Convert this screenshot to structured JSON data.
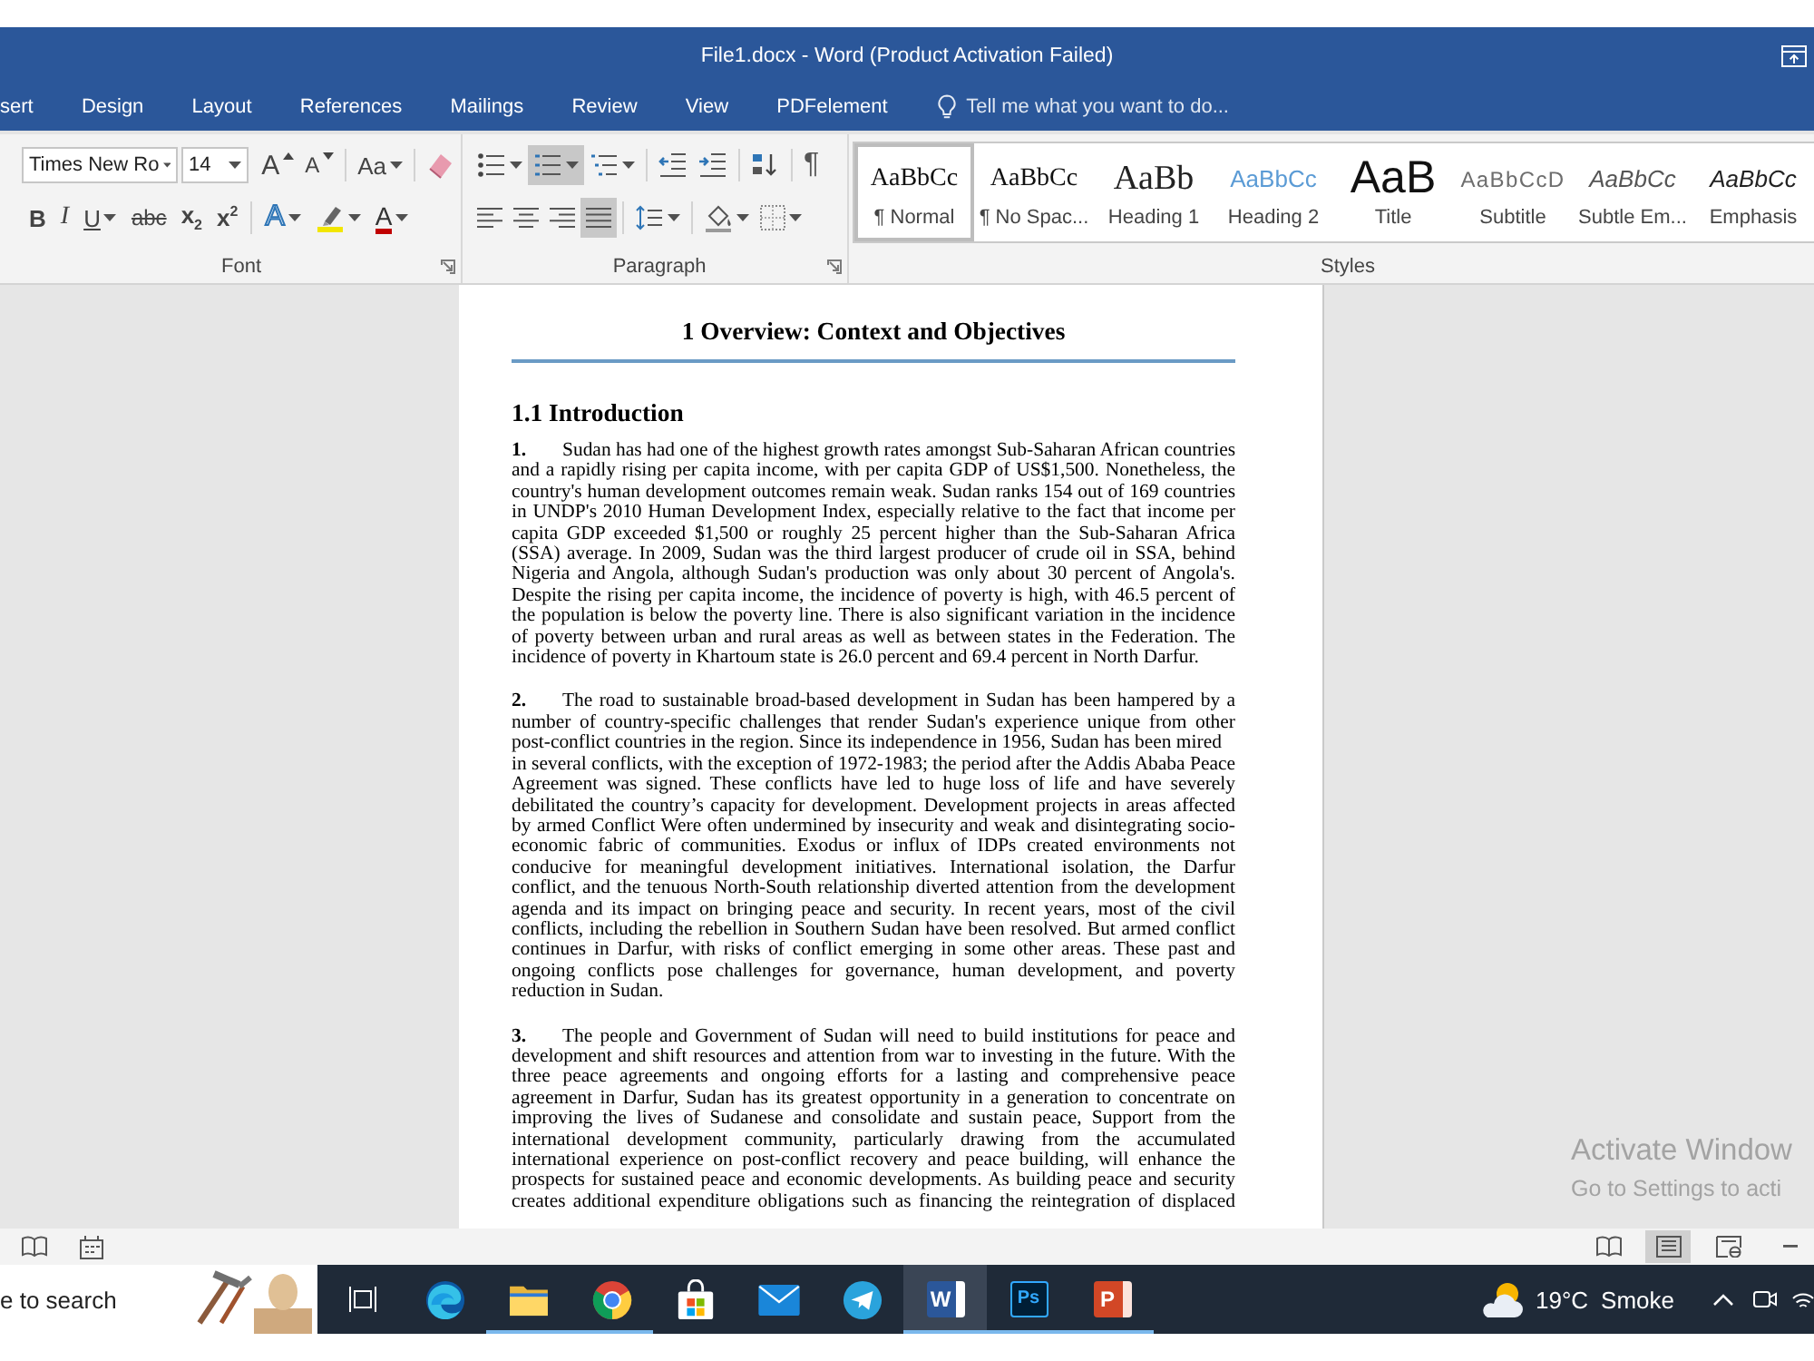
{
  "window": {
    "title": "File1.docx - Word (Product Activation Failed)"
  },
  "tabs": [
    {
      "label": "sert",
      "selected": false
    },
    {
      "label": "Design",
      "selected": false
    },
    {
      "label": "Layout",
      "selected": false
    },
    {
      "label": "References",
      "selected": false
    },
    {
      "label": "Mailings",
      "selected": false
    },
    {
      "label": "Review",
      "selected": false
    },
    {
      "label": "View",
      "selected": false
    },
    {
      "label": "PDFelement",
      "selected": false
    }
  ],
  "tell_me": {
    "placeholder": "Tell me what you want to do..."
  },
  "ribbon": {
    "font": {
      "label": "Font",
      "font_name": "Times New Ro",
      "font_size": "14",
      "row1": [
        {
          "kind": "grow",
          "label": "A"
        },
        {
          "kind": "shrink",
          "label": "A"
        },
        {
          "kind": "case",
          "label": "Aa"
        },
        {
          "kind": "clear"
        }
      ],
      "row2": [
        {
          "kind": "bold",
          "label": "B"
        },
        {
          "kind": "italic",
          "label": "I"
        },
        {
          "kind": "underline",
          "label": "U"
        },
        {
          "kind": "strike",
          "label": "abc"
        },
        {
          "kind": "sub",
          "label": "x$_{2}$"
        },
        {
          "kind": "super",
          "label": "x$^{2}$"
        },
        {
          "kind": "effects",
          "label": "A"
        },
        {
          "kind": "highlight"
        },
        {
          "kind": "color",
          "label": "A"
        }
      ]
    },
    "paragraph": {
      "label": "Paragraph",
      "row1": [
        {
          "kind": "bullets",
          "selected": false
        },
        {
          "kind": "numbering",
          "selected": true
        },
        {
          "kind": "multilevel",
          "selected": false
        },
        {
          "kind": "outdent",
          "selected": false
        },
        {
          "kind": "indent",
          "selected": false
        },
        {
          "kind": "sort",
          "selected": false
        },
        {
          "kind": "marks",
          "label": "¶",
          "selected": false
        }
      ],
      "row2": [
        {
          "kind": "left",
          "selected": false
        },
        {
          "kind": "center",
          "selected": false
        },
        {
          "kind": "right",
          "selected": false
        },
        {
          "kind": "justify",
          "selected": true
        },
        {
          "kind": "spacing",
          "selected": false
        },
        {
          "kind": "shading",
          "selected": false
        },
        {
          "kind": "borders",
          "selected": false
        }
      ]
    },
    "styles": {
      "label": "Styles",
      "items": [
        {
          "kind": "normal",
          "preview": "AaBbCc",
          "name": "¶ Normal",
          "selected": true
        },
        {
          "kind": "normal",
          "preview": "AaBbCc",
          "name": "¶ No Spac...",
          "selected": false
        },
        {
          "kind": "heading1",
          "preview": "AaBb",
          "name": "Heading 1",
          "selected": false
        },
        {
          "kind": "heading2",
          "preview": "AaBbCc",
          "name": "Heading 2",
          "selected": false
        },
        {
          "kind": "title",
          "preview": "AaB",
          "name": "Title",
          "selected": false
        },
        {
          "kind": "subtitle",
          "preview": "AaBbCcD",
          "name": "Subtitle",
          "selected": false
        },
        {
          "kind": "subtle",
          "preview": "AaBbCc",
          "name": "Subtle Em...",
          "selected": false
        },
        {
          "kind": "emphasis",
          "preview": "AaBbCc",
          "name": "Emphasis",
          "selected": false
        }
      ]
    }
  },
  "document": {
    "title": "1 Overview: Context and Objectives",
    "section": "1.1 Introduction",
    "paragraphs": [
      {
        "number": "1.",
        "text": "Sudan has had one of the highest growth rates amongst Sub-Saharan African countries and a rapidly rising per capita income, with per capita GDP of US$1,500. Nonetheless, the country's human development outcomes remain weak. Sudan ranks 154 out of 169 countries in UNDP's 2010 Human Development Index, especially relative to the fact that income per capita GDP exceeded $1,500 or roughly 25 percent higher than the Sub-Saharan Africa (SSA) average. In 2009, Sudan was the third largest producer of crude oil in SSA, behind Nigeria and Angola, although Sudan's production was only about 30 percent of Angola's. Despite the rising per capita income, the incidence of poverty is high, with 46.5 percent of the population is below the poverty line. There is also significant variation in the incidence of poverty between urban and rural areas as well as between states in the Federation. The incidence of poverty in Khartoum state is 26.0 percent and 69.4 percent in North Darfur."
      },
      {
        "number": "2.",
        "text": "The road to sustainable broad-based development in Sudan has been hampered by a number of country-specific challenges that render Sudan's experience unique from other post-conflict countries in the region. Since its independence in 1956, Sudan has been mired\nin several conflicts, with the exception of 1972-1983; the period after the Addis Ababa Peace Agreement was signed. These conflicts have led to huge loss of life and have severely debilitated the country’s capacity for development. Development projects in areas affected by armed Conflict Were often undermined by insecurity and weak and disintegrating socio-economic fabric of communities. Exodus or influx of IDPs created environments not conducive for meaningful development initiatives. International isolation, the Darfur conflict, and the tenuous North-South relationship diverted attention from the development agenda and its impact on bringing peace and security. In recent years, most of the civil conflicts, including the rebellion in Southern Sudan have been resolved. But armed conflict continues in Darfur, with risks of conflict emerging in some other areas. These past and ongoing conflicts pose challenges for governance, human development, and poverty reduction in Sudan."
      },
      {
        "number": "3.",
        "text": "The people and Government of Sudan will need to build institutions for peace and development and shift resources and attention from war to investing in the future. With the three peace agreements and ongoing efforts for a lasting and comprehensive peace agreement in Darfur, Sudan has its greatest opportunity in a generation to concentrate on improving the lives of Sudanese and consolidate and sustain peace, Support from the international development community, particularly drawing from the accumulated international experience on post-conflict recovery and peace building, will enhance the prospects for sustained peace and economic developments. As building peace and security creates additional expenditure obligations such as financing the reintegration of displaced"
      }
    ]
  },
  "activation_notice": {
    "title": "Activate Window",
    "message": "Go to Settings to acti"
  },
  "status_bar": {
    "views": [
      {
        "kind": "read",
        "selected": false
      },
      {
        "kind": "print",
        "selected": true
      },
      {
        "kind": "web",
        "selected": false
      }
    ]
  },
  "taskbar": {
    "search": {
      "placeholder": "e to search"
    },
    "apps": [
      {
        "kind": "edge",
        "running": false,
        "selected": false
      },
      {
        "kind": "explorer",
        "running": true,
        "selected": false
      },
      {
        "kind": "chrome",
        "running": true,
        "selected": false
      },
      {
        "kind": "store",
        "running": false,
        "selected": false
      },
      {
        "kind": "mail",
        "running": false,
        "selected": false
      },
      {
        "kind": "telegram",
        "running": false,
        "selected": false
      },
      {
        "kind": "word",
        "label": "W",
        "running": true,
        "selected": true
      },
      {
        "kind": "photoshop",
        "label": "Ps",
        "running": true,
        "selected": false
      },
      {
        "kind": "powerpoint",
        "label": "P",
        "running": true,
        "selected": false
      }
    ],
    "weather": {
      "temperature": "19°C",
      "condition": "Smoke"
    }
  }
}
